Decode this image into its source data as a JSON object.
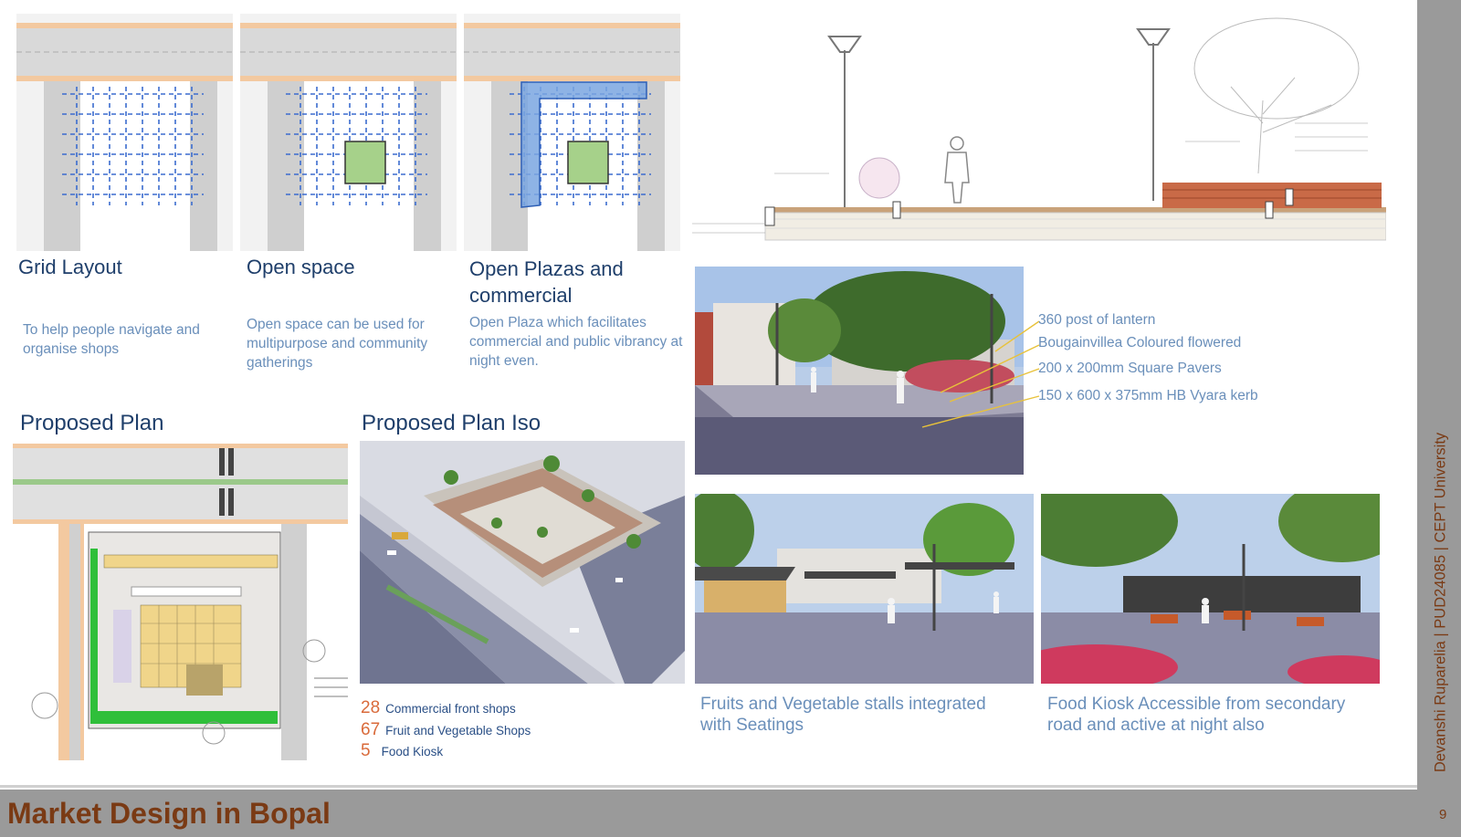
{
  "diagrams": {
    "grid": {
      "title": "Grid Layout",
      "desc": "To help people navigate and organise shops"
    },
    "open": {
      "title": "Open space",
      "desc": "Open space can be used for multipurpose and community gatherings"
    },
    "plaza": {
      "title": "Open Plazas and commercial",
      "desc": "Open Plaza which facilitates commercial and public vibrancy at night even."
    }
  },
  "plans": {
    "plan_title": "Proposed Plan",
    "iso_title": "Proposed Plan Iso"
  },
  "stats": [
    {
      "num": "28",
      "label": "Commercial front shops"
    },
    {
      "num": "67",
      "label": "Fruit and Vegetable Shops"
    },
    {
      "num": "5",
      "label": "Food Kiosk"
    }
  ],
  "annotations": [
    "360 post of lantern",
    "Bougainvillea Coloured flowered",
    "200 x 200mm Square Pavers",
    "150 x 600 x 375mm HB Vyara kerb"
  ],
  "captions": {
    "stalls": "Fruits and Vegetable stalls integrated with Seatings",
    "kiosk": "Food Kiosk Accessible from secondary road and active at night also"
  },
  "footer": {
    "title": "Market Design in Bopal",
    "page": "9"
  },
  "sidebar": {
    "credit": "Devanshi Ruparelia | PUD24085 | CEPT University"
  },
  "colors": {
    "brand": "#7a3a14",
    "title": "#1f3f6b",
    "text": "#6a8fba",
    "accent": "#d96a3a",
    "band": "#9a9a9a"
  }
}
